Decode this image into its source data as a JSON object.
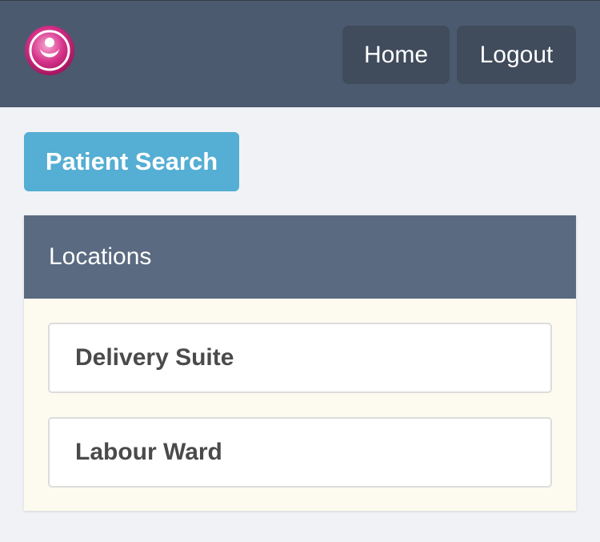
{
  "colors": {
    "navbar": "#4c5a6f",
    "nav_button": "#404b5c",
    "primary_button": "#55aed3",
    "panel_header": "#5a6a80",
    "panel_body": "#fdfbef",
    "logo": "#d6338a"
  },
  "header": {
    "logo_icon": "app-logo-icon",
    "nav": [
      {
        "label": "Home"
      },
      {
        "label": "Logout"
      }
    ]
  },
  "actions": {
    "patient_search_label": "Patient Search"
  },
  "locations": {
    "title": "Locations",
    "items": [
      {
        "label": "Delivery Suite"
      },
      {
        "label": "Labour Ward"
      }
    ]
  }
}
